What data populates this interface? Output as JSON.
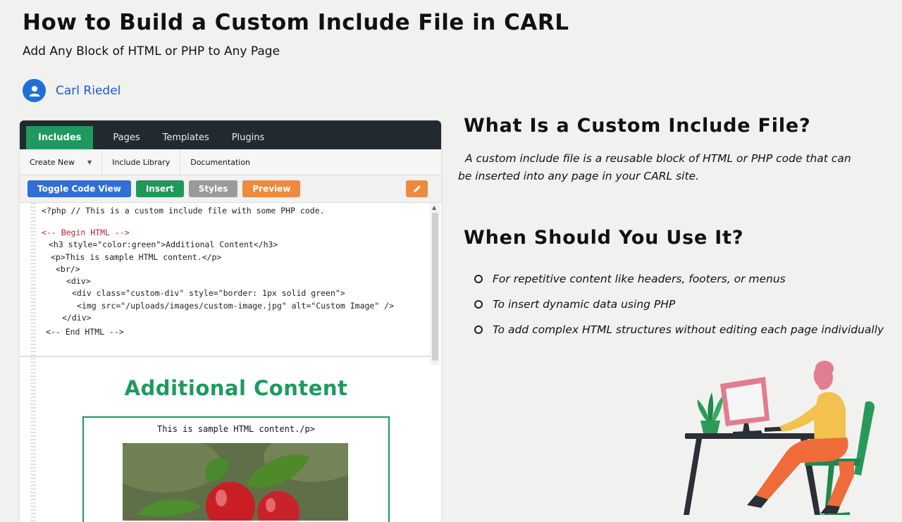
{
  "article": {
    "title": "How to Build a Custom Include File in CARL",
    "subtitle": "Add Any Block of HTML or PHP to Any Page",
    "author": "Carl Riedel"
  },
  "cms": {
    "tabs": [
      "Includes",
      "Pages",
      "Templates",
      "Plugins"
    ],
    "subnav": {
      "create_new": "Create New",
      "include_library": "Include Library",
      "documentation": "Documentation"
    },
    "toolbar": {
      "toggle_code_view": "Toggle Code View",
      "insert": "Insert",
      "styles": "Styles",
      "preview": "Preview"
    },
    "code_lines": [
      "<?php // This is a custom include file with some PHP code.",
      "<-- Begin HTML -->",
      "<h3 style=\"color:green\">Additional Content</h3>",
      "<p>This is sample HTML content.</p>",
      "<br/>",
      "<div>",
      "<div class=\"custom-div\" style=\"border: 1px solid green\">",
      "<img src=\"/uploads/images/custom-image.jpg\" alt=\"Custom Image\" />",
      "</div>",
      "<-- End HTML -->"
    ],
    "preview": {
      "heading": "Additional Content",
      "text": "This is sample HTML content./p>"
    }
  },
  "sections": {
    "what_heading": "What Is a Custom Include File?",
    "what_text": "A custom include file is a reusable block of HTML or PHP code that can be inserted into any page in your CARL site.",
    "when_heading": "When Should You Use It?",
    "when_items": [
      "For repetitive content like headers, footers, or menus",
      "To insert dynamic data using PHP",
      "To add complex HTML structures without editing each page individually"
    ]
  },
  "colors": {
    "brand_green": "#1e9a5e",
    "nav_dark": "#222a31",
    "link_blue": "#1a5ccc",
    "accent_orange": "#ee8a3d"
  }
}
